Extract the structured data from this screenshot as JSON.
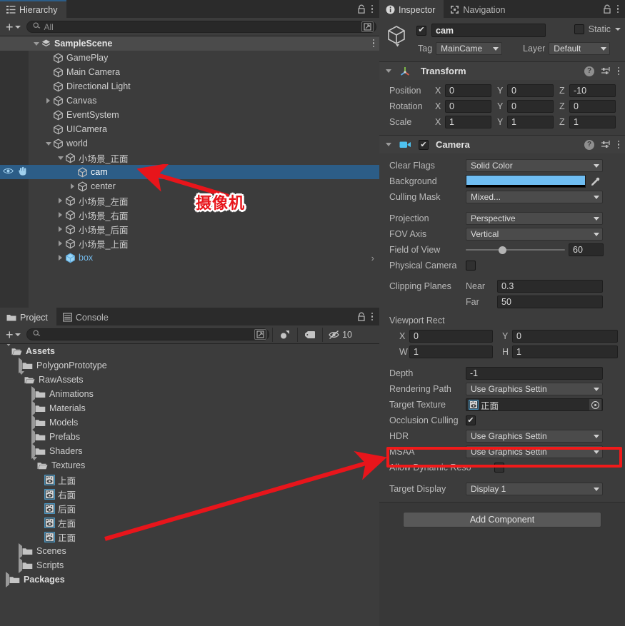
{
  "hierarchy": {
    "tab_label": "Hierarchy",
    "tab_icon": "hierarchy-icon",
    "search_placeholder": "All",
    "search_value": "All",
    "add_label": "+",
    "rows": [
      {
        "label": "SampleScene",
        "indent": 1,
        "twist": "down",
        "icon": "scene-icon",
        "kind": "scene"
      },
      {
        "label": "GamePlay",
        "indent": 2,
        "twist": "none",
        "icon": "gameobject-cube-icon",
        "kind": "go"
      },
      {
        "label": "Main Camera",
        "indent": 2,
        "twist": "none",
        "icon": "gameobject-cube-icon",
        "kind": "go"
      },
      {
        "label": "Directional Light",
        "indent": 2,
        "twist": "none",
        "icon": "gameobject-cube-icon",
        "kind": "go"
      },
      {
        "label": "Canvas",
        "indent": 2,
        "twist": "right",
        "icon": "gameobject-cube-icon",
        "kind": "go"
      },
      {
        "label": "EventSystem",
        "indent": 2,
        "twist": "none",
        "icon": "gameobject-cube-icon",
        "kind": "go"
      },
      {
        "label": "UICamera",
        "indent": 2,
        "twist": "none",
        "icon": "gameobject-cube-icon",
        "kind": "go"
      },
      {
        "label": "world",
        "indent": 2,
        "twist": "down",
        "icon": "gameobject-cube-icon",
        "kind": "go"
      },
      {
        "label": "小场景_正面",
        "indent": 3,
        "twist": "down",
        "icon": "gameobject-cube-icon",
        "kind": "go"
      },
      {
        "label": "cam",
        "indent": 4,
        "twist": "none",
        "icon": "gameobject-cube-icon",
        "kind": "selected"
      },
      {
        "label": "center",
        "indent": 4,
        "twist": "right",
        "icon": "gameobject-cube-icon",
        "kind": "go"
      },
      {
        "label": "小场景_左面",
        "indent": 3,
        "twist": "right",
        "icon": "gameobject-cube-icon",
        "kind": "go"
      },
      {
        "label": "小场景_右面",
        "indent": 3,
        "twist": "right",
        "icon": "gameobject-cube-icon",
        "kind": "go"
      },
      {
        "label": "小场景_后面",
        "indent": 3,
        "twist": "right",
        "icon": "gameobject-cube-icon",
        "kind": "go"
      },
      {
        "label": "小场景_上面",
        "indent": 3,
        "twist": "right",
        "icon": "gameobject-cube-icon",
        "kind": "go"
      },
      {
        "label": "box",
        "indent": 3,
        "twist": "right",
        "icon": "prefab-cube-icon",
        "kind": "prefab"
      }
    ]
  },
  "inspector": {
    "tabs": [
      {
        "label": "Inspector",
        "icon": "info-icon",
        "active": true
      },
      {
        "label": "Navigation",
        "icon": "navigation-icon",
        "active": false
      }
    ],
    "object": {
      "enabled": true,
      "name": "cam",
      "static_label": "Static",
      "static_checked": false,
      "tag_label": "Tag",
      "tag_value": "MainCame",
      "layer_label": "Layer",
      "layer_value": "Default"
    },
    "transform": {
      "title": "Transform",
      "rows": [
        {
          "label": "Position",
          "x": "0",
          "y": "0",
          "z": "-10"
        },
        {
          "label": "Rotation",
          "x": "0",
          "y": "0",
          "z": "0"
        },
        {
          "label": "Scale",
          "x": "1",
          "y": "1",
          "z": "1"
        }
      ]
    },
    "camera": {
      "title": "Camera",
      "enabled": true,
      "clear_flags_label": "Clear Flags",
      "clear_flags_value": "Solid Color",
      "background_label": "Background",
      "background_color": "#6fbdf2",
      "culling_mask_label": "Culling Mask",
      "culling_mask_value": "Mixed...",
      "projection_label": "Projection",
      "projection_value": "Perspective",
      "fov_axis_label": "FOV Axis",
      "fov_axis_value": "Vertical",
      "field_of_view_label": "Field of View",
      "field_of_view_value": "60",
      "field_of_view_pct": 33,
      "physical_camera_label": "Physical Camera",
      "physical_camera_checked": false,
      "clipping_planes_label": "Clipping Planes",
      "near_label": "Near",
      "near_value": "0.3",
      "far_label": "Far",
      "far_value": "50",
      "viewport_rect_label": "Viewport Rect",
      "viewport_x": "0",
      "viewport_y": "0",
      "viewport_w": "1",
      "viewport_h": "1",
      "depth_label": "Depth",
      "depth_value": "-1",
      "rendering_path_label": "Rendering Path",
      "rendering_path_value": "Use Graphics Settin",
      "target_texture_label": "Target Texture",
      "target_texture_value": "正面",
      "occlusion_culling_label": "Occlusion Culling",
      "occlusion_culling_checked": true,
      "hdr_label": "HDR",
      "hdr_value": "Use Graphics Settin",
      "msaa_label": "MSAA",
      "msaa_value": "Use Graphics Settin",
      "allow_dynamic_label": "Allow Dynamic Reso",
      "allow_dynamic_checked": false,
      "target_display_label": "Target Display",
      "target_display_value": "Display 1"
    },
    "add_component_label": "Add Component"
  },
  "project": {
    "tabs": [
      {
        "label": "Project",
        "icon": "folder-icon",
        "active": true
      },
      {
        "label": "Console",
        "icon": "console-icon",
        "active": false
      }
    ],
    "search_value": "",
    "search_placeholder": "",
    "hidden_count": "10",
    "rows": [
      {
        "label": "Assets",
        "indent": 0,
        "twist": "down",
        "icon": "folder-open-icon",
        "bold": true
      },
      {
        "label": "PolygonPrototype",
        "indent": 1,
        "twist": "right",
        "icon": "folder-icon",
        "bold": false
      },
      {
        "label": "RawAssets",
        "indent": 1,
        "twist": "down",
        "icon": "folder-open-icon",
        "bold": false
      },
      {
        "label": "Animations",
        "indent": 2,
        "twist": "right",
        "icon": "folder-icon",
        "bold": false
      },
      {
        "label": "Materials",
        "indent": 2,
        "twist": "right",
        "icon": "folder-icon",
        "bold": false
      },
      {
        "label": "Models",
        "indent": 2,
        "twist": "right",
        "icon": "folder-icon",
        "bold": false
      },
      {
        "label": "Prefabs",
        "indent": 2,
        "twist": "right",
        "icon": "folder-icon",
        "bold": false
      },
      {
        "label": "Shaders",
        "indent": 2,
        "twist": "right",
        "icon": "folder-icon",
        "bold": false
      },
      {
        "label": "Textures",
        "indent": 2,
        "twist": "down",
        "icon": "folder-open-icon",
        "bold": false
      },
      {
        "label": "上面",
        "indent": 3,
        "twist": "none",
        "icon": "render-texture-icon",
        "bold": false
      },
      {
        "label": "右面",
        "indent": 3,
        "twist": "none",
        "icon": "render-texture-icon",
        "bold": false
      },
      {
        "label": "后面",
        "indent": 3,
        "twist": "none",
        "icon": "render-texture-icon",
        "bold": false
      },
      {
        "label": "左面",
        "indent": 3,
        "twist": "none",
        "icon": "render-texture-icon",
        "bold": false
      },
      {
        "label": "正面",
        "indent": 3,
        "twist": "none",
        "icon": "render-texture-icon",
        "bold": false
      },
      {
        "label": "Scenes",
        "indent": 1,
        "twist": "right",
        "icon": "folder-icon",
        "bold": false
      },
      {
        "label": "Scripts",
        "indent": 1,
        "twist": "right",
        "icon": "folder-icon",
        "bold": false
      },
      {
        "label": "Packages",
        "indent": 0,
        "twist": "right",
        "icon": "folder-icon",
        "bold": true
      }
    ]
  },
  "annotations": {
    "camera_callout": "摄像机",
    "arrow_color": "#e8151b",
    "highlight_color": "#f01a1a"
  }
}
